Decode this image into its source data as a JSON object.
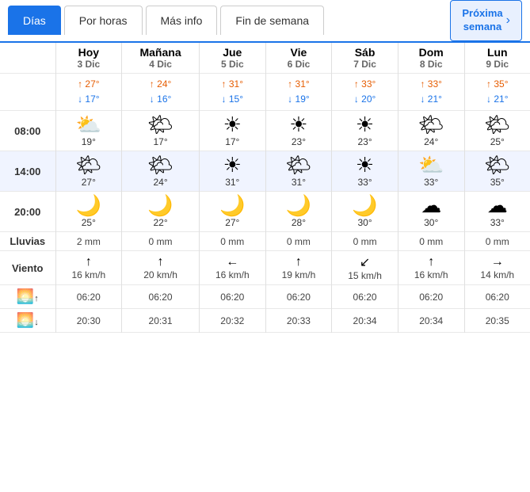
{
  "tabs": [
    {
      "label": "Días",
      "active": true
    },
    {
      "label": "Por horas",
      "active": false
    },
    {
      "label": "Más info",
      "active": false
    },
    {
      "label": "Fin de semana",
      "active": false
    }
  ],
  "proxima": {
    "label": "Próxima\nsemana",
    "arrow": "›"
  },
  "days": [
    {
      "name": "Hoy",
      "date": "3 Dic",
      "high": "27°",
      "low": "17°",
      "t08": "19°",
      "t14": "27°",
      "t20": "25°",
      "lluvia": "2 mm",
      "viento_dir": "↑",
      "viento_spd": "16 km/h",
      "amanecer": "06:20",
      "anochecer": "20:30",
      "icon08": "⛅",
      "icon14": "🌤",
      "icon20": "🌙"
    },
    {
      "name": "Mañana",
      "date": "4 Dic",
      "high": "24°",
      "low": "16°",
      "t08": "17°",
      "t14": "24°",
      "t20": "22°",
      "lluvia": "0 mm",
      "viento_dir": "↑",
      "viento_spd": "20 km/h",
      "amanecer": "06:20",
      "anochecer": "20:31",
      "icon08": "🌤",
      "icon14": "🌤",
      "icon20": "🌙"
    },
    {
      "name": "Jue",
      "date": "5 Dic",
      "high": "31°",
      "low": "15°",
      "t08": "17°",
      "t14": "31°",
      "t20": "27°",
      "lluvia": "0 mm",
      "viento_dir": "←",
      "viento_spd": "16 km/h",
      "amanecer": "06:20",
      "anochecer": "20:32",
      "icon08": "☀",
      "icon14": "☀",
      "icon20": "🌙"
    },
    {
      "name": "Vie",
      "date": "6 Dic",
      "high": "31°",
      "low": "19°",
      "t08": "23°",
      "t14": "31°",
      "t20": "28°",
      "lluvia": "0 mm",
      "viento_dir": "↑",
      "viento_spd": "19 km/h",
      "amanecer": "06:20",
      "anochecer": "20:33",
      "icon08": "☀",
      "icon14": "🌤",
      "icon20": "🌙"
    },
    {
      "name": "Sáb",
      "date": "7 Dic",
      "high": "33°",
      "low": "20°",
      "t08": "23°",
      "t14": "33°",
      "t20": "30°",
      "lluvia": "0 mm",
      "viento_dir": "↙",
      "viento_spd": "15 km/h",
      "amanecer": "06:20",
      "anochecer": "20:34",
      "icon08": "☀",
      "icon14": "☀",
      "icon20": "🌙"
    },
    {
      "name": "Dom",
      "date": "8 Dic",
      "high": "33°",
      "low": "21°",
      "t08": "24°",
      "t14": "33°",
      "t20": "30°",
      "lluvia": "0 mm",
      "viento_dir": "↑",
      "viento_spd": "16 km/h",
      "amanecer": "06:20",
      "anochecer": "20:34",
      "icon08": "🌤",
      "icon14": "⛅",
      "icon20": "☁"
    },
    {
      "name": "Lun",
      "date": "9 Dic",
      "high": "35°",
      "low": "21°",
      "t08": "25°",
      "t14": "35°",
      "t20": "33°",
      "lluvia": "0 mm",
      "viento_dir": "→",
      "viento_spd": "14 km/h",
      "amanecer": "06:20",
      "anochecer": "20:35",
      "icon08": "🌤",
      "icon14": "🌤",
      "icon20": "☁"
    }
  ],
  "row_labels": {
    "lluvia": "Lluvias",
    "viento": "Viento",
    "time08": "08:00",
    "time14": "14:00",
    "time20": "20:00"
  }
}
